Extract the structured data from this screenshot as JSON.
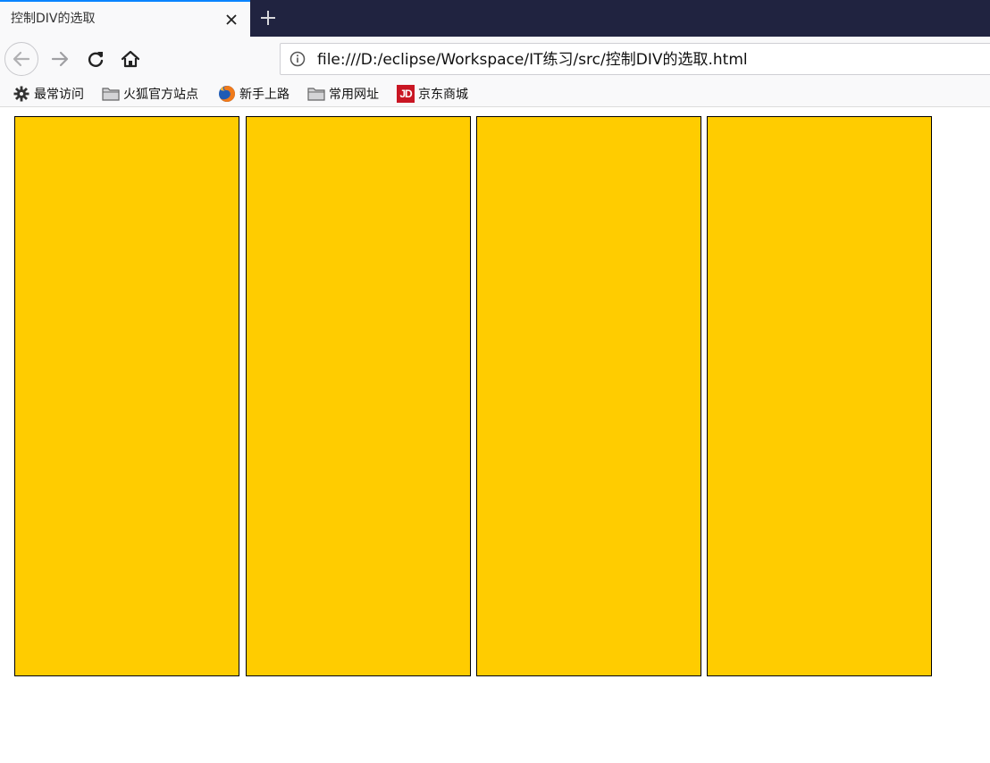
{
  "tab": {
    "title": "控制DIV的选取",
    "close_icon": "close-icon",
    "new_tab_icon": "plus-icon",
    "accent_color": "#0a84ff"
  },
  "nav": {
    "back_icon": "back-arrow-icon",
    "forward_icon": "forward-arrow-icon",
    "reload_icon": "reload-icon",
    "home_icon": "home-icon",
    "url_info_icon": "info-icon",
    "url": "file:///D:/eclipse/Workspace/IT练习/src/控制DIV的选取.html"
  },
  "bookmarks": [
    {
      "label": "最常访问",
      "icon": "gear-icon"
    },
    {
      "label": "火狐官方站点",
      "icon": "folder-icon"
    },
    {
      "label": "新手上路",
      "icon": "firefox-icon"
    },
    {
      "label": "常用网址",
      "icon": "folder-icon"
    },
    {
      "label": "京东商城",
      "icon": "jd-logo-icon"
    }
  ],
  "jd_logo_text": "JD",
  "page": {
    "box_color": "#ffcc00",
    "box_count": 4
  }
}
